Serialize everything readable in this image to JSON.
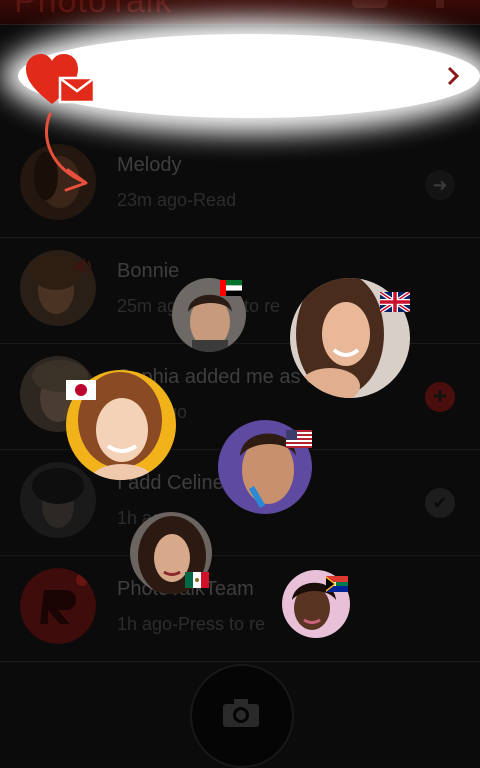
{
  "app": {
    "title": "PhotoTalk"
  },
  "conversations": [
    {
      "name": "Melody",
      "subtitle": "23m ago-Read"
    },
    {
      "name": "Bonnie",
      "subtitle": "25m ago-Press to re"
    },
    {
      "name": "Sophia added me as a",
      "subtitle": "30m ago"
    },
    {
      "name": "I add Celine as friend",
      "subtitle": "1h ago"
    },
    {
      "name": "PhotoTalkTeam",
      "subtitle": "1h ago-Press to re"
    }
  ],
  "colors": {
    "accent": "#e52b1c",
    "background": "#0b0b0b"
  },
  "icons": {
    "banner": "heart-envelope-icon",
    "pointer": "curved-arrow-icon",
    "camera": "camera-icon"
  },
  "floating_flags": [
    "uae",
    "uk",
    "japan",
    "usa",
    "mexico",
    "south-africa"
  ]
}
